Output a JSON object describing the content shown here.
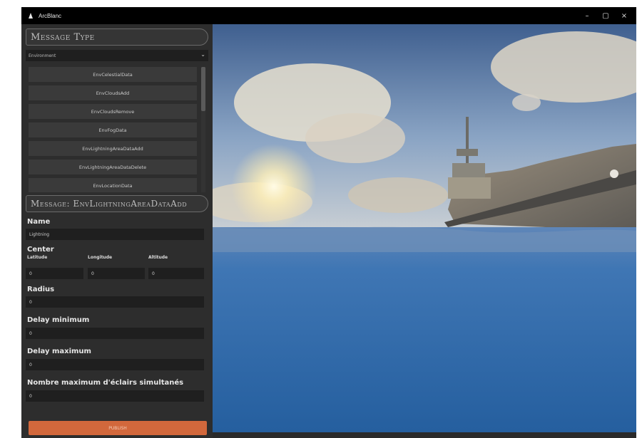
{
  "window": {
    "title": "ArcBlanc",
    "controls": {
      "minimize": "–",
      "maximize": "▢",
      "close": "×"
    }
  },
  "message_type": {
    "header": "Message Type",
    "select_value": "Environment",
    "items": [
      "EnvCelestialData",
      "EnvCloudsAdd",
      "EnvCloudsRemove",
      "EnvFogData",
      "EnvLightningAreaDataAdd",
      "EnvLightningAreaDataDelete",
      "EnvLocationData"
    ]
  },
  "message_form": {
    "header": "Message: EnvLightningAreaDataAdd",
    "name_label": "Name",
    "name_value": "Lightning",
    "center_label": "Center",
    "latitude_label": "Latitude",
    "longitude_label": "Longitude",
    "altitude_label": "Altitude",
    "latitude_value": "0",
    "longitude_value": "0",
    "altitude_value": "0",
    "radius_label": "Radius",
    "radius_value": "0",
    "delay_min_label": "Delay minimum",
    "delay_min_value": "0",
    "delay_max_label": "Delay maximum",
    "delay_max_value": "0",
    "max_simultaneous_label": "Nombre maximum d'éclairs simultanés",
    "max_simultaneous_value": "0",
    "submit_label": "PUBLISH"
  },
  "colors": {
    "accent": "#d2683c",
    "panel": "#2d2d2d",
    "input": "#1f1f1f",
    "titlebar": "#000000"
  }
}
